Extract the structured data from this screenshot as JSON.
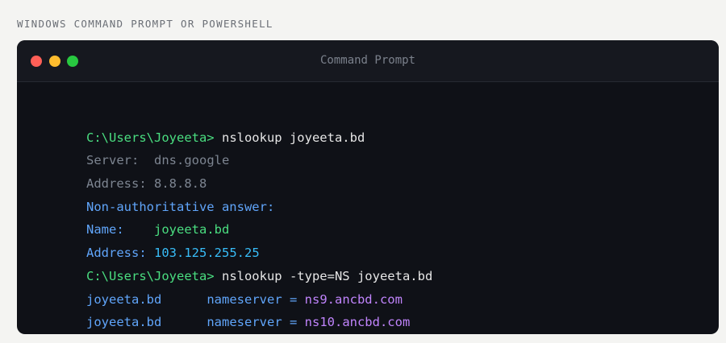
{
  "caption": "WINDOWS COMMAND PROMPT OR POWERSHELL",
  "window": {
    "title": "Command Prompt"
  },
  "colors": {
    "prompt": "#4ade80",
    "command": "#e6e6e6",
    "muted": "#7d8591",
    "info": "#60a5fa",
    "value": "#4ade80",
    "ip": "#38bdf8",
    "nameserver": "#c084fc"
  },
  "lines": [
    {
      "prompt": "C:\\Users\\Joyeeta>",
      "command": "nslookup joyeeta.bd"
    },
    {
      "label": "Server:",
      "value": "dns.google"
    },
    {
      "label": "Address:",
      "value": "8.8.8.8"
    },
    {
      "text": "Non-authoritative answer:"
    },
    {
      "label": "Name:",
      "value": "joyeeta.bd"
    },
    {
      "label": "Address:",
      "value": "103.125.255.25"
    },
    {
      "prompt": "C:\\Users\\Joyeeta>",
      "command": "nslookup -type=NS joyeeta.bd"
    },
    {
      "domain": "joyeeta.bd",
      "key": "nameserver =",
      "value": "ns9.ancbd.com"
    },
    {
      "domain": "joyeeta.bd",
      "key": "nameserver =",
      "value": "ns10.ancbd.com"
    }
  ]
}
